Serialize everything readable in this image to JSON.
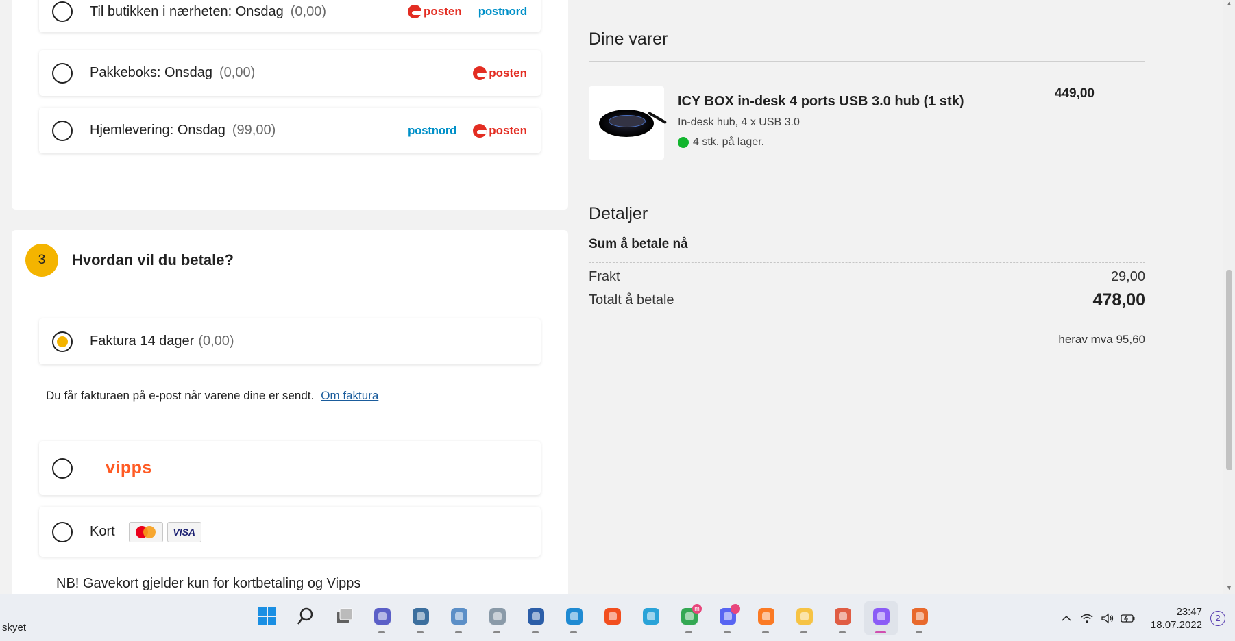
{
  "shipping": {
    "options": [
      {
        "label": "Til butikken i nærheten: Onsdag",
        "price": "(0,00)",
        "logos": [
          "posten",
          "postnord"
        ]
      },
      {
        "label": "Pakkeboks: Onsdag",
        "price": "(0,00)",
        "logos": [
          "posten"
        ]
      },
      {
        "label": "Hjemlevering: Onsdag",
        "price": "(99,00)",
        "logos": [
          "postnord",
          "posten"
        ]
      }
    ],
    "logo_text": {
      "posten": "posten",
      "postnord": "postnord"
    }
  },
  "payment": {
    "step_number": "3",
    "title": "Hvordan vil du betale?",
    "invoice_label": "Faktura 14 dager",
    "invoice_price": "(0,00)",
    "invoice_info": "Du får fakturaen på e-post når varene dine er sendt.",
    "invoice_link": "Om faktura",
    "vipps_label": "vipps",
    "card_label": "Kort",
    "visa_text": "VISA",
    "note": "NB! Gavekort gjelder kun for kortbetaling og Vipps"
  },
  "cart": {
    "title": "Dine varer",
    "item": {
      "name": "ICY BOX in-desk 4 ports USB 3.0 hub (1 stk)",
      "description": "In-desk hub, 4 x USB 3.0",
      "stock": "4 stk. på lager.",
      "price": "449,00"
    }
  },
  "details": {
    "title": "Detaljer",
    "sum_label": "Sum å betale nå",
    "shipping_label": "Frakt",
    "shipping_value": "29,00",
    "total_label": "Totalt å betale",
    "total_value": "478,00",
    "vat": "herav mva 95,60"
  },
  "taskbar": {
    "left_text": "skyet",
    "apps": [
      {
        "name": "windows-start",
        "color": "#1a8fe3"
      },
      {
        "name": "search",
        "color": "#2b2b2b"
      },
      {
        "name": "task-view",
        "color": "#606060"
      },
      {
        "name": "teams-chat",
        "color": "#5b5fc7"
      },
      {
        "name": "settings",
        "color": "#3c6f9e"
      },
      {
        "name": "monitor",
        "color": "#5c8fc7"
      },
      {
        "name": "folder-app",
        "color": "#8a9aa8"
      },
      {
        "name": "terminal",
        "color": "#2c5ea8"
      },
      {
        "name": "vscode",
        "color": "#1f8ad2"
      },
      {
        "name": "figma",
        "color": "#f24e1e"
      },
      {
        "name": "search-app",
        "color": "#2aa3d8"
      },
      {
        "name": "chrome",
        "color": "#34a853"
      },
      {
        "name": "discord",
        "color": "#5865f2"
      },
      {
        "name": "xampp",
        "color": "#fb7a24"
      },
      {
        "name": "file-explorer",
        "color": "#f6c344"
      },
      {
        "name": "git-app",
        "color": "#e05d44"
      },
      {
        "name": "snipping-tool",
        "color": "#8b5cf6"
      },
      {
        "name": "faststone",
        "color": "#e8692c"
      }
    ],
    "chrome_badge": "m",
    "time": "23:47",
    "date": "18.07.2022",
    "notifications": "2"
  }
}
